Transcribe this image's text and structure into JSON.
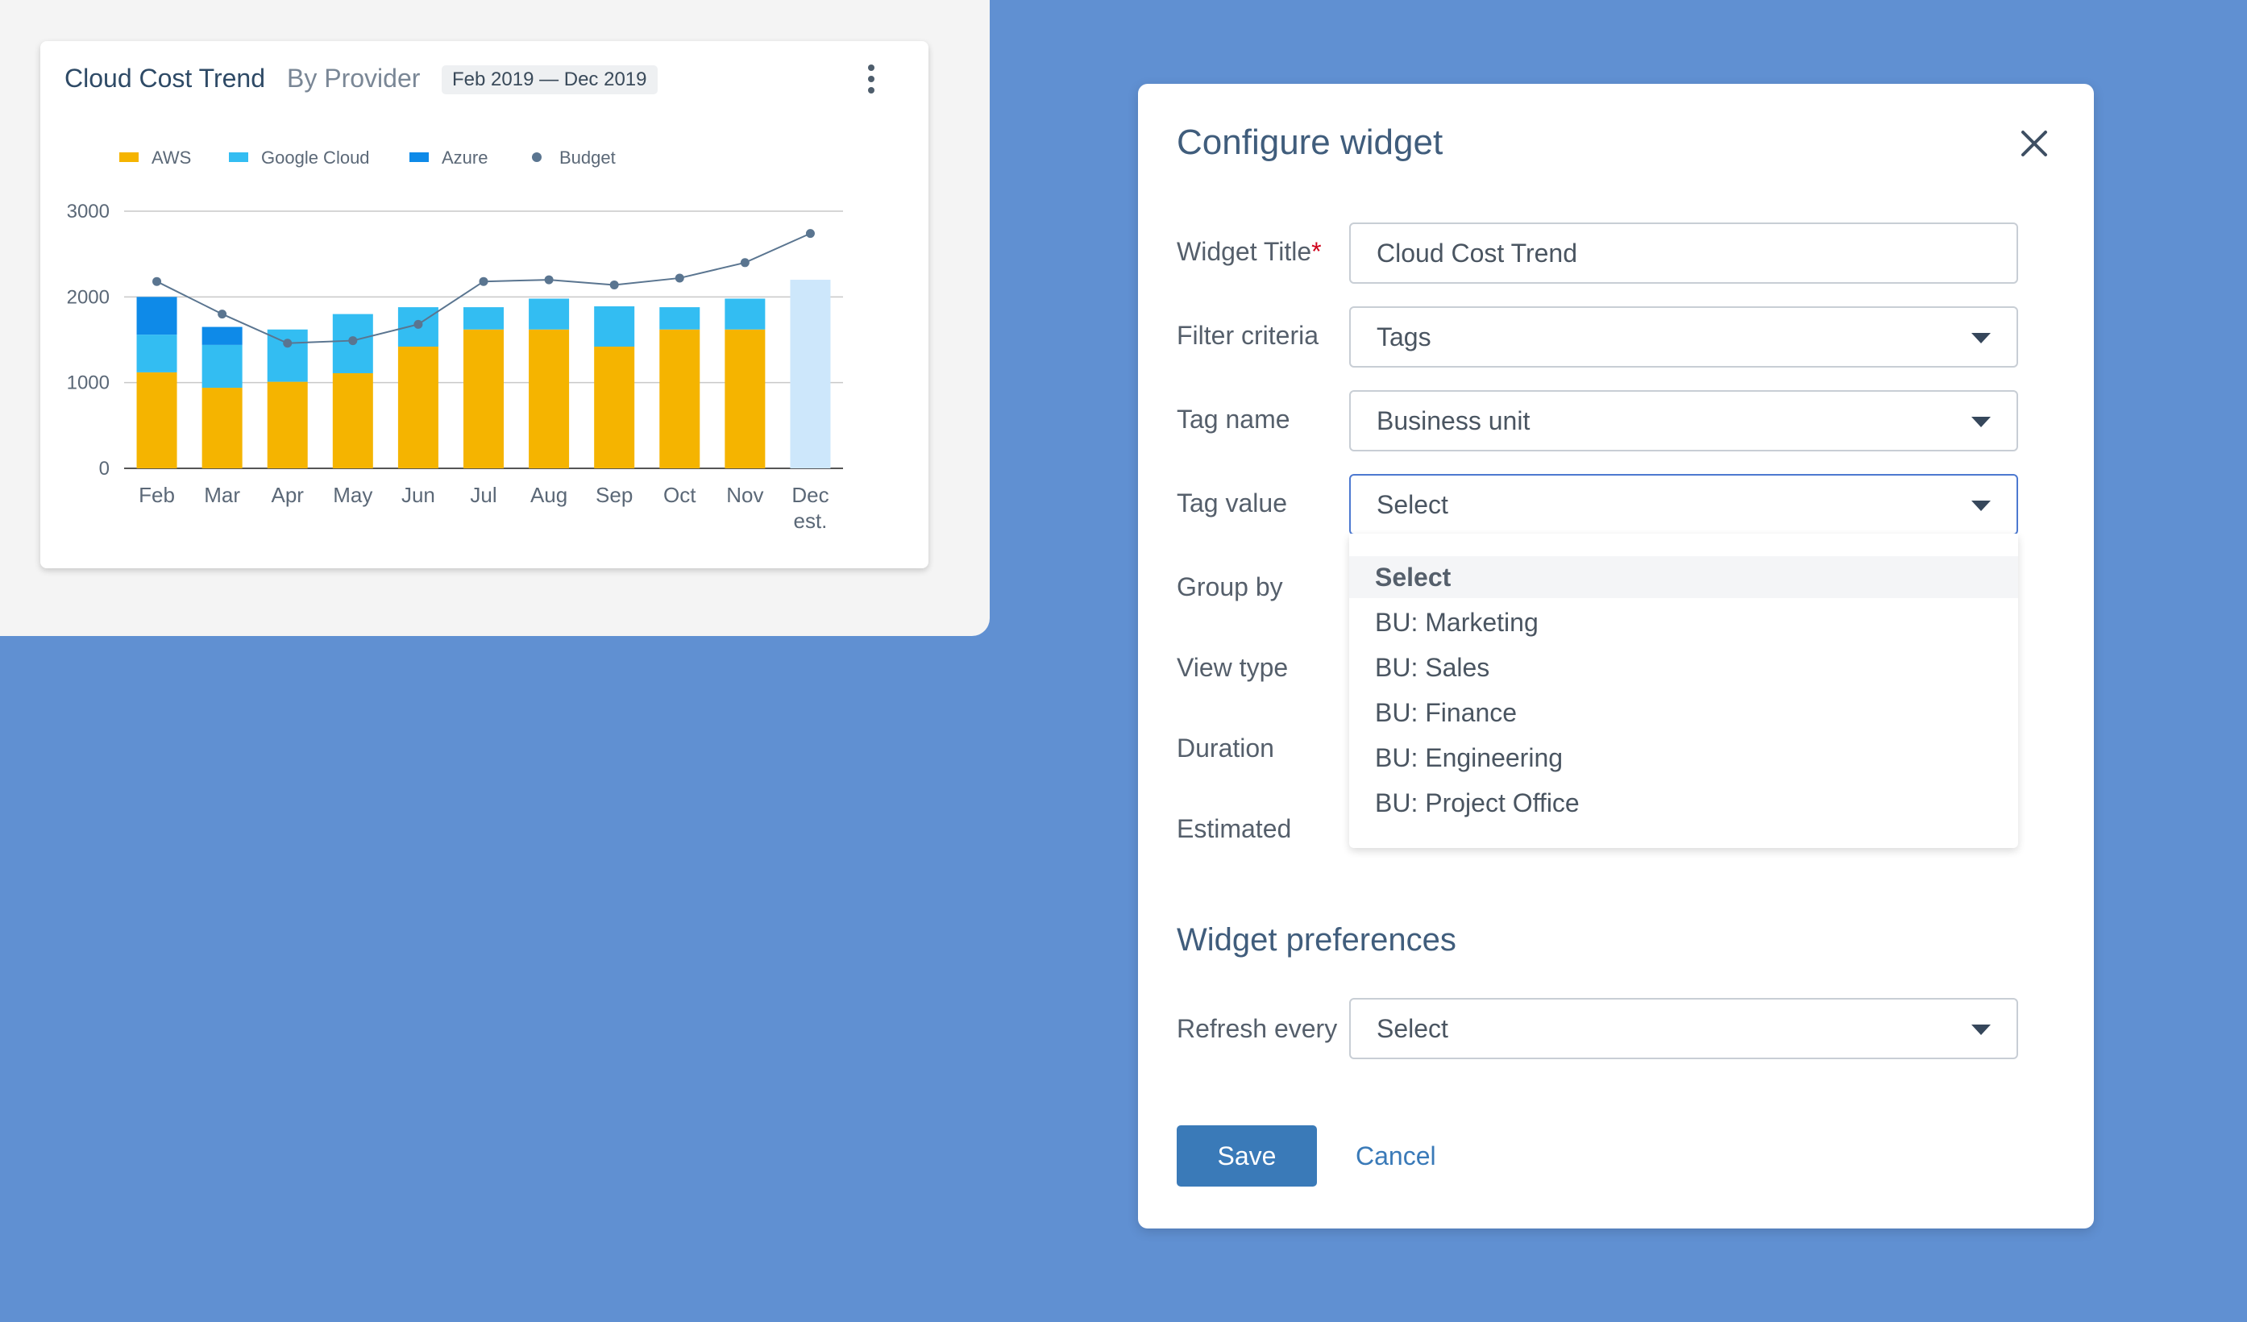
{
  "chart_card": {
    "title": "Cloud Cost Trend",
    "subtitle": "By Provider",
    "date_range": "Feb 2019 — Dec 2019",
    "menu_icon": "kebab-menu-icon"
  },
  "chart_data": {
    "type": "bar",
    "stacked": true,
    "title": "Cloud Cost Trend",
    "subtitle": "By Provider",
    "categories": [
      "Feb",
      "Mar",
      "Apr",
      "May",
      "Jun",
      "Jul",
      "Aug",
      "Sep",
      "Oct",
      "Nov",
      "Dec est."
    ],
    "series": [
      {
        "name": "AWS",
        "color": "#f5b400",
        "values": [
          1120,
          940,
          1010,
          1110,
          1420,
          1620,
          1620,
          1420,
          1620,
          1620,
          null
        ]
      },
      {
        "name": "Google Cloud",
        "color": "#33bdf2",
        "values": [
          440,
          500,
          610,
          690,
          460,
          260,
          360,
          470,
          260,
          360,
          null
        ]
      },
      {
        "name": "Azure",
        "color": "#0e8ae8",
        "values": [
          440,
          210,
          0,
          0,
          0,
          0,
          0,
          0,
          0,
          0,
          null
        ]
      }
    ],
    "estimate": {
      "name": "Dec est.",
      "color": "#cde7fb",
      "value": 2200
    },
    "line_series": {
      "name": "Budget",
      "color": "#5a7590",
      "values": [
        2180,
        1800,
        1460,
        1490,
        1680,
        2180,
        2200,
        2140,
        2220,
        2400,
        2740
      ]
    },
    "yticks": [
      0,
      1000,
      2000,
      3000
    ],
    "ylim": [
      0,
      3000
    ],
    "grid": true,
    "legend_position": "top-left"
  },
  "dialog": {
    "title": "Configure widget",
    "close_icon": "close-icon",
    "fields": {
      "widget_title_label": "Widget Title",
      "widget_title_required": "*",
      "widget_title_value": "Cloud Cost Trend",
      "filter_criteria_label": "Filter criteria",
      "filter_criteria_value": "Tags",
      "tag_name_label": "Tag name",
      "tag_name_value": "Business unit",
      "tag_value_label": "Tag value",
      "tag_value_value": "Select",
      "group_by_label": "Group by",
      "view_type_label": "View type",
      "duration_label": "Duration",
      "estimated_label": "Estimated"
    },
    "tag_value_options": [
      "Select",
      "BU: Marketing",
      "BU: Sales",
      "BU: Finance",
      "BU: Engineering",
      "BU: Project Office"
    ],
    "preferences_title": "Widget preferences",
    "refresh_label": "Refresh every",
    "refresh_value": "Select",
    "save_label": "Save",
    "cancel_label": "Cancel"
  }
}
